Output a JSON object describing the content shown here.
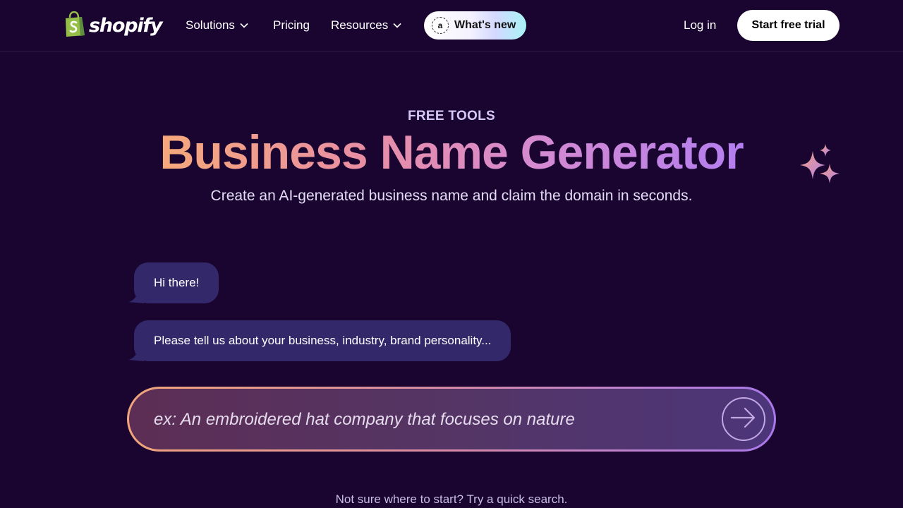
{
  "brand": {
    "name": "shopify",
    "logo_color": "#95bf47"
  },
  "nav": {
    "items": [
      {
        "label": "Solutions",
        "has_dropdown": true
      },
      {
        "label": "Pricing",
        "has_dropdown": false
      },
      {
        "label": "Resources",
        "has_dropdown": true
      }
    ],
    "whats_new": {
      "label": "What's new",
      "badge_glyph": "a"
    },
    "login_label": "Log in",
    "cta_label": "Start free trial"
  },
  "hero": {
    "eyebrow": "FREE TOOLS",
    "title": "Business Name Generator",
    "subtitle": "Create an AI-generated business name and claim the domain in seconds.",
    "sparkle_icon": "sparkles-icon"
  },
  "chat": {
    "messages": [
      "Hi there!",
      "Please tell us about your business, industry, brand personality..."
    ]
  },
  "prompt_input": {
    "value": "",
    "placeholder": "ex: An embroidered hat company that focuses on nature",
    "submit_icon": "arrow-right-icon"
  },
  "quick_search_hint": "Not sure where to start? Try a quick search.",
  "colors": {
    "background": "#1a0530",
    "bubble": "#33286a",
    "title_gradient_start": "#f6a97a",
    "title_gradient_end": "#b37ef0"
  }
}
